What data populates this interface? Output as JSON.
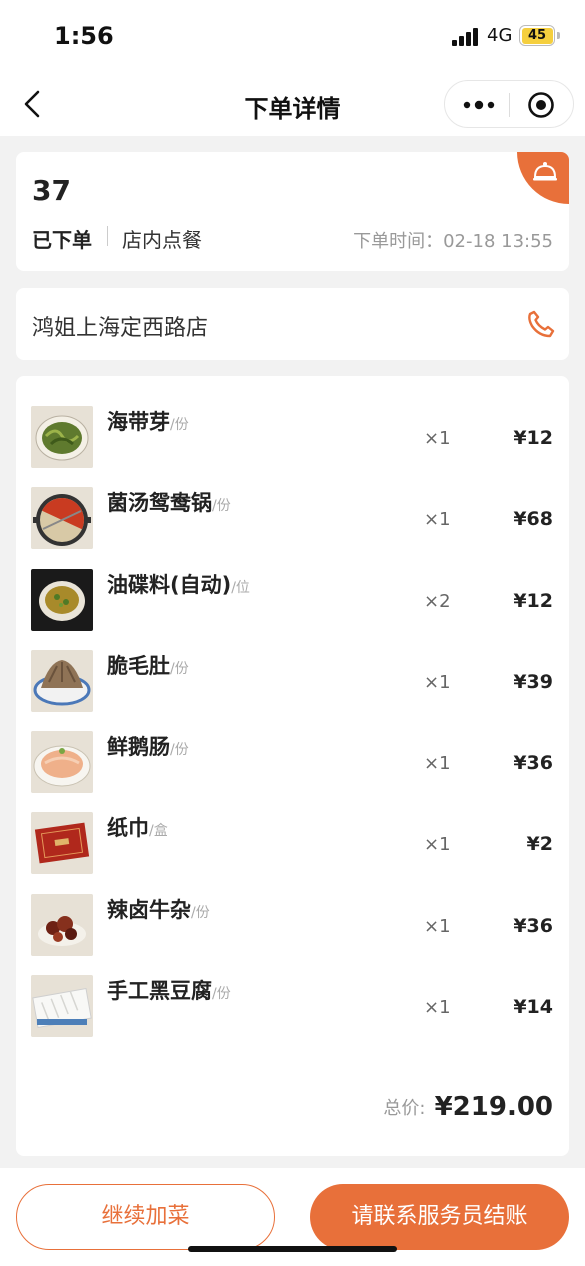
{
  "status_bar": {
    "time": "1:56",
    "network": "4G",
    "battery": "45"
  },
  "nav": {
    "title": "下单详情",
    "back_icon": "chevron-left-icon",
    "more_icon": "more-dots-icon",
    "close_icon": "target-close-icon"
  },
  "order": {
    "number": "37",
    "status": "已下单",
    "type": "店内点餐",
    "time": "下单时间：02-18 13:55",
    "badge_icon": "service-bell-icon"
  },
  "store": {
    "name": "鸿姐上海定西路店",
    "phone_icon": "phone-icon"
  },
  "items": [
    {
      "name": "海带芽",
      "unit": "/份",
      "qty": "×1",
      "price": "¥12",
      "thumb_icon": "seaweed-dish-thumb"
    },
    {
      "name": "菌汤鸳鸯锅",
      "unit": "/份",
      "qty": "×1",
      "price": "¥68",
      "thumb_icon": "hotpot-thumb"
    },
    {
      "name": "油碟料(自动)",
      "unit": "/位",
      "qty": "×2",
      "price": "¥12",
      "thumb_icon": "oil-dip-thumb"
    },
    {
      "name": "脆毛肚",
      "unit": "/份",
      "qty": "×1",
      "price": "¥39",
      "thumb_icon": "tripe-thumb"
    },
    {
      "name": "鲜鹅肠",
      "unit": "/份",
      "qty": "×1",
      "price": "¥36",
      "thumb_icon": "goose-intestine-thumb"
    },
    {
      "name": "纸巾",
      "unit": "/盒",
      "qty": "×1",
      "price": "¥2",
      "thumb_icon": "tissue-box-thumb"
    },
    {
      "name": "辣卤牛杂",
      "unit": "/份",
      "qty": "×1",
      "price": "¥36",
      "thumb_icon": "beef-offal-thumb"
    },
    {
      "name": "手工黑豆腐",
      "unit": "/份",
      "qty": "×1",
      "price": "¥14",
      "thumb_icon": "tofu-thumb"
    }
  ],
  "total": {
    "label": "总价:",
    "value": "¥219.00"
  },
  "actions": {
    "add_more": "继续加菜",
    "checkout": "请联系服务员结账"
  },
  "colors": {
    "accent": "#e8703a",
    "background": "#f2f2f2"
  }
}
